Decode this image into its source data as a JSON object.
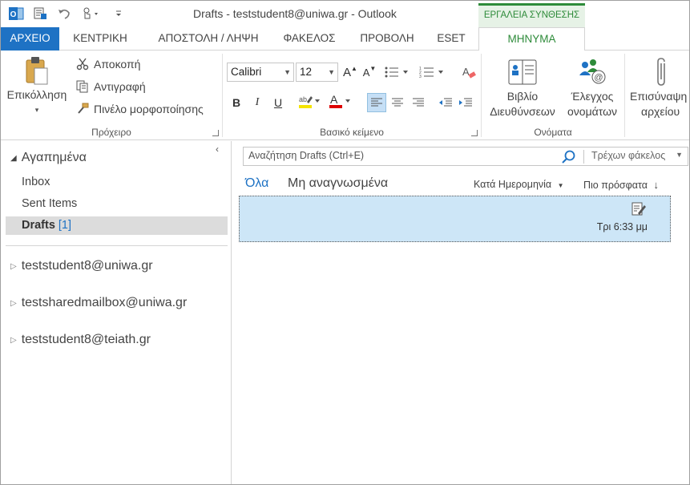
{
  "window": {
    "title": "Drafts - teststudent8@uniwa.gr - Outlook",
    "contextual_tab_header": "ΕΡΓΑΛΕΙΑ ΣΥΝΘΕΣΗΣ"
  },
  "ribbon_tabs": {
    "file": "ΑΡΧΕΙΟ",
    "home": "ΚΕΝΤΡΙΚΗ",
    "send_receive": "ΑΠΟΣΤΟΛΗ / ΛΗΨΗ",
    "folder": "ΦΑΚΕΛΟΣ",
    "view": "ΠΡΟΒΟΛΗ",
    "eset": "ESET",
    "message": "ΜΗΝΥΜΑ"
  },
  "clipboard": {
    "paste_label": "Επικόλληση",
    "cut_label": "Αποκοπή",
    "copy_label": "Αντιγραφή",
    "format_painter_label": "Πινέλο μορφοποίησης",
    "group_label": "Πρόχειρο"
  },
  "basic_text": {
    "font_name": "Calibri",
    "font_size": "12",
    "group_label": "Βασικό κείμενο"
  },
  "names": {
    "address_book_line1": "Βιβλίο",
    "address_book_line2": "Διευθύνσεων",
    "check_names_line1": "Έλεγχος",
    "check_names_line2": "ονομάτων",
    "group_label": "Ονόματα"
  },
  "include": {
    "attach_line1": "Επισύναψη",
    "attach_line2": "αρχείου"
  },
  "nav": {
    "favorites_label": "Αγαπημένα",
    "inbox": "Inbox",
    "sent_items": "Sent Items",
    "drafts": "Drafts",
    "drafts_count": "[1]",
    "accounts": [
      "teststudent8@uniwa.gr",
      "testsharedmailbox@uniwa.gr",
      "teststudent8@teiath.gr"
    ]
  },
  "search": {
    "placeholder": "Αναζήτηση Drafts (Ctrl+E)",
    "scope": "Τρέχων φάκελος"
  },
  "list": {
    "filter_all": "Όλα",
    "filter_unread": "Μη αναγνωσμένα",
    "sort_by": "Κατά Ημερομηνία",
    "order": "Πιο πρόσφατα",
    "items": [
      {
        "time": "Τρι 6:33 μμ"
      }
    ]
  },
  "colors": {
    "accent_blue": "#1e72c4",
    "contextual_green": "#2e8b3a",
    "selected_item": "#cde6f7"
  }
}
